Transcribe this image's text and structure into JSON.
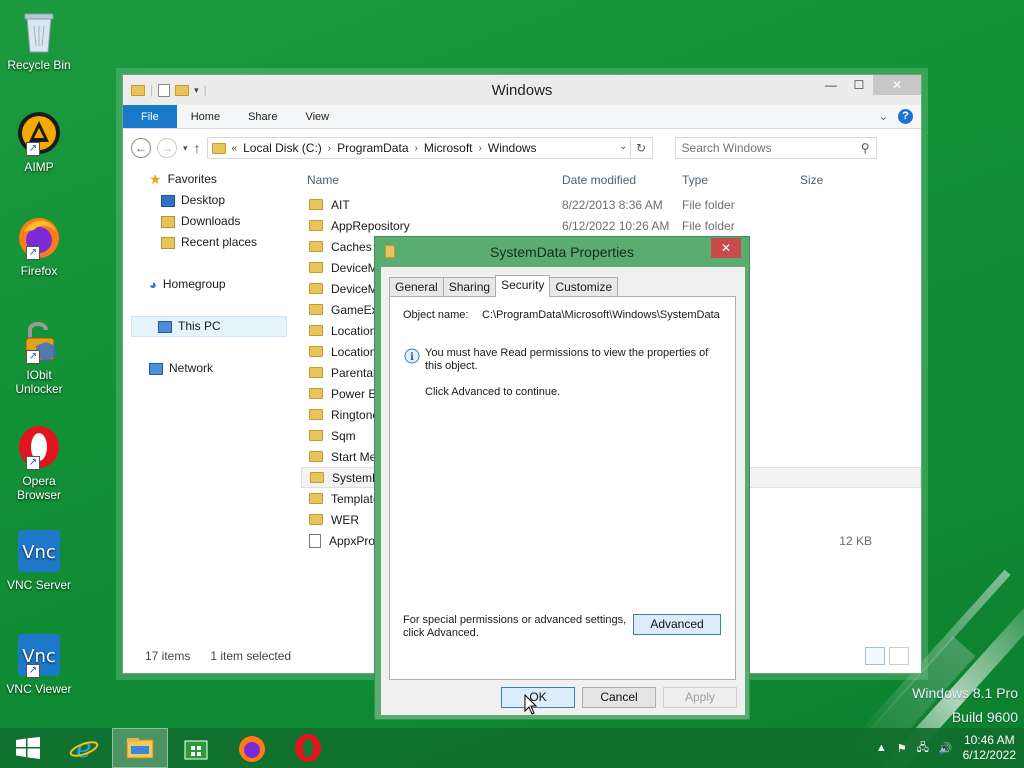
{
  "desktop": {
    "icons": [
      {
        "label": "Recycle Bin"
      },
      {
        "label": "AIMP"
      },
      {
        "label": "Firefox"
      },
      {
        "label": "IObit Unlocker"
      },
      {
        "label": "Opera Browser"
      },
      {
        "label": "VNC Server"
      },
      {
        "label": "VNC Viewer"
      }
    ],
    "watermark_line1": "Windows 8.1 Pro",
    "watermark_line2": "Build 9600"
  },
  "explorer": {
    "title": "Windows",
    "ribbon_tabs": [
      "File",
      "Home",
      "Share",
      "View"
    ],
    "address": {
      "overflow": "«",
      "crumbs": [
        "Local Disk (C:)",
        "ProgramData",
        "Microsoft",
        "Windows"
      ]
    },
    "search_placeholder": "Search Windows",
    "nav": {
      "favorites": "Favorites",
      "desktop": "Desktop",
      "downloads": "Downloads",
      "recent": "Recent places",
      "homegroup": "Homegroup",
      "thispc": "This PC",
      "network": "Network"
    },
    "columns": {
      "name": "Name",
      "date": "Date modified",
      "type": "Type",
      "size": "Size"
    },
    "rows": [
      {
        "name": "AIT",
        "date": "8/22/2013 8:36 AM",
        "type": "File folder",
        "size": ""
      },
      {
        "name": "AppRepository",
        "date": "6/12/2022 10:26 AM",
        "type": "File folder",
        "size": ""
      },
      {
        "name": "Caches",
        "date": "",
        "type": "",
        "size": ""
      },
      {
        "name": "DeviceM",
        "date": "",
        "type": "",
        "size": ""
      },
      {
        "name": "DeviceM",
        "date": "",
        "type": "",
        "size": ""
      },
      {
        "name": "GameExp",
        "date": "",
        "type": "",
        "size": ""
      },
      {
        "name": "Location",
        "date": "",
        "type": "",
        "size": ""
      },
      {
        "name": "Location",
        "date": "",
        "type": "",
        "size": ""
      },
      {
        "name": "Parental",
        "date": "",
        "type": "",
        "size": ""
      },
      {
        "name": "Power Ef",
        "date": "",
        "type": "",
        "size": ""
      },
      {
        "name": "Ringtone",
        "date": "",
        "type": "",
        "size": ""
      },
      {
        "name": "Sqm",
        "date": "",
        "type": "",
        "size": ""
      },
      {
        "name": "Start Mer",
        "date": "",
        "type": "",
        "size": ""
      },
      {
        "name": "SystemD",
        "date": "",
        "type": "",
        "size": ""
      },
      {
        "name": "Template",
        "date": "",
        "type": "",
        "size": ""
      },
      {
        "name": "WER",
        "date": "",
        "type": "",
        "size": ""
      },
      {
        "name": "AppxProv",
        "date": "",
        "type": "ment",
        "size": "12 KB"
      }
    ],
    "status_items": "17 items",
    "status_selected": "1 item selected"
  },
  "dialog": {
    "title": "SystemData Properties",
    "tabs": [
      "General",
      "Sharing",
      "Security",
      "Customize"
    ],
    "object_name_label": "Object name:",
    "object_name_value": "C:\\ProgramData\\Microsoft\\Windows\\SystemData",
    "info_message": "You must have Read permissions to view the properties of this object.",
    "continue_message": "Click Advanced to continue.",
    "special_permissions": "For special permissions or advanced settings, click Advanced.",
    "advanced_label": "Advanced",
    "ok_label": "OK",
    "cancel_label": "Cancel",
    "apply_label": "Apply"
  },
  "taskbar": {
    "time": "10:46 AM",
    "date": "6/12/2022"
  }
}
